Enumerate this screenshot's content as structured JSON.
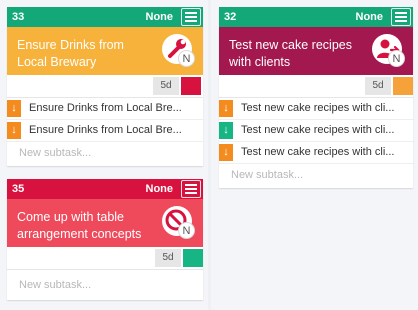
{
  "cards": [
    {
      "id": "33",
      "status": "None",
      "title": "Ensure Drinks from Local Brewary",
      "badge_icon": "wrench-icon",
      "badge_letter": "N",
      "days": "5d",
      "header_color": "#14a879",
      "body_color": "#f6b23a",
      "priority_color": "#d8123f",
      "subtasks": [
        {
          "direction": "down",
          "color": "#f38b1f",
          "text": "Ensure Drinks from Local Bre..."
        },
        {
          "direction": "down",
          "color": "#f38b1f",
          "text": "Ensure Drinks from Local Bre..."
        }
      ],
      "new_subtask_placeholder": "New subtask..."
    },
    {
      "id": "32",
      "status": "None",
      "title": "Test new cake recipes with clients",
      "badge_icon": "user-arrow-icon",
      "badge_letter": "N",
      "days": "5d",
      "header_color": "#14a879",
      "body_color": "#a3194f",
      "priority_color": "#f6a23a",
      "subtasks": [
        {
          "direction": "down",
          "color": "#f38b1f",
          "text": "Test new cake recipes with cli..."
        },
        {
          "direction": "down",
          "color": "#18b584",
          "text": "Test new cake recipes with cli..."
        },
        {
          "direction": "down",
          "color": "#f38b1f",
          "text": "Test new cake recipes with cli..."
        }
      ],
      "new_subtask_placeholder": "New subtask..."
    },
    {
      "id": "35",
      "status": "None",
      "title": "Come up with table arrangement concepts",
      "badge_icon": "blocked-icon",
      "badge_letter": "N",
      "days": "5d",
      "header_color": "#d8123f",
      "body_color": "#ef4a5b",
      "priority_color": "#18b584",
      "subtasks": [],
      "new_subtask_placeholder": "New subtask..."
    }
  ]
}
